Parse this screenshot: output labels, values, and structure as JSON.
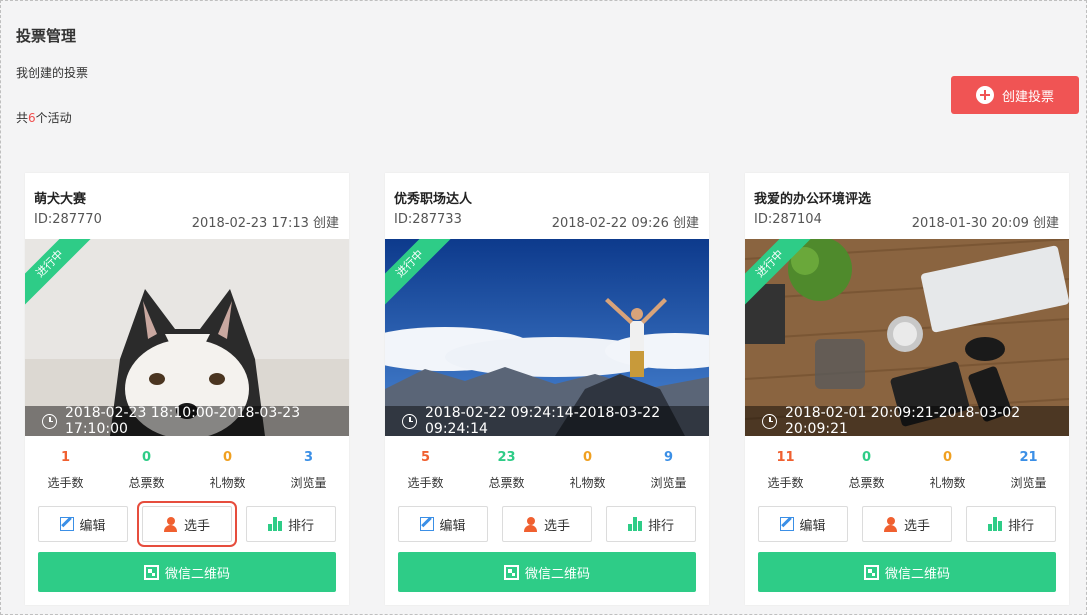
{
  "header": {
    "title": "投票管理",
    "section": "我创建的投票",
    "count_prefix": "共",
    "count_value": "6",
    "count_suffix": "个活动",
    "create_button": "创建投票"
  },
  "labels": {
    "status": "进行中",
    "stat_players": "选手数",
    "stat_votes": "总票数",
    "stat_gifts": "礼物数",
    "stat_views": "浏览量",
    "edit": "编辑",
    "players": "选手",
    "rank": "排行",
    "qr": "微信二维码"
  },
  "colors": {
    "accent_red": "#f05454",
    "accent_green": "#2ecc87",
    "stat_players": "#f06030",
    "stat_votes": "#2ecc87",
    "stat_gifts": "#f0a020",
    "stat_views": "#3b8fe6"
  },
  "cards": [
    {
      "name": "萌犬大赛",
      "id": "ID:287770",
      "created": "2018-02-23 17:13 创建",
      "period": "2018-02-23 18:10:00-2018-03-23 17:10:00",
      "image": "husky-dog-photo",
      "stats": {
        "players": "1",
        "votes": "0",
        "gifts": "0",
        "views": "3"
      }
    },
    {
      "name": "优秀职场达人",
      "id": "ID:287733",
      "created": "2018-02-22 09:26 创建",
      "period": "2018-02-22 09:24:14-2018-03-22 09:24:14",
      "image": "mountain-summit-photo",
      "stats": {
        "players": "5",
        "votes": "23",
        "gifts": "0",
        "views": "9"
      }
    },
    {
      "name": "我爱的办公环境评选",
      "id": "ID:287104",
      "created": "2018-01-30 20:09 创建",
      "period": "2018-02-01 20:09:21-2018-03-02 20:09:21",
      "image": "office-desk-photo",
      "stats": {
        "players": "11",
        "votes": "0",
        "gifts": "0",
        "views": "21"
      }
    }
  ]
}
